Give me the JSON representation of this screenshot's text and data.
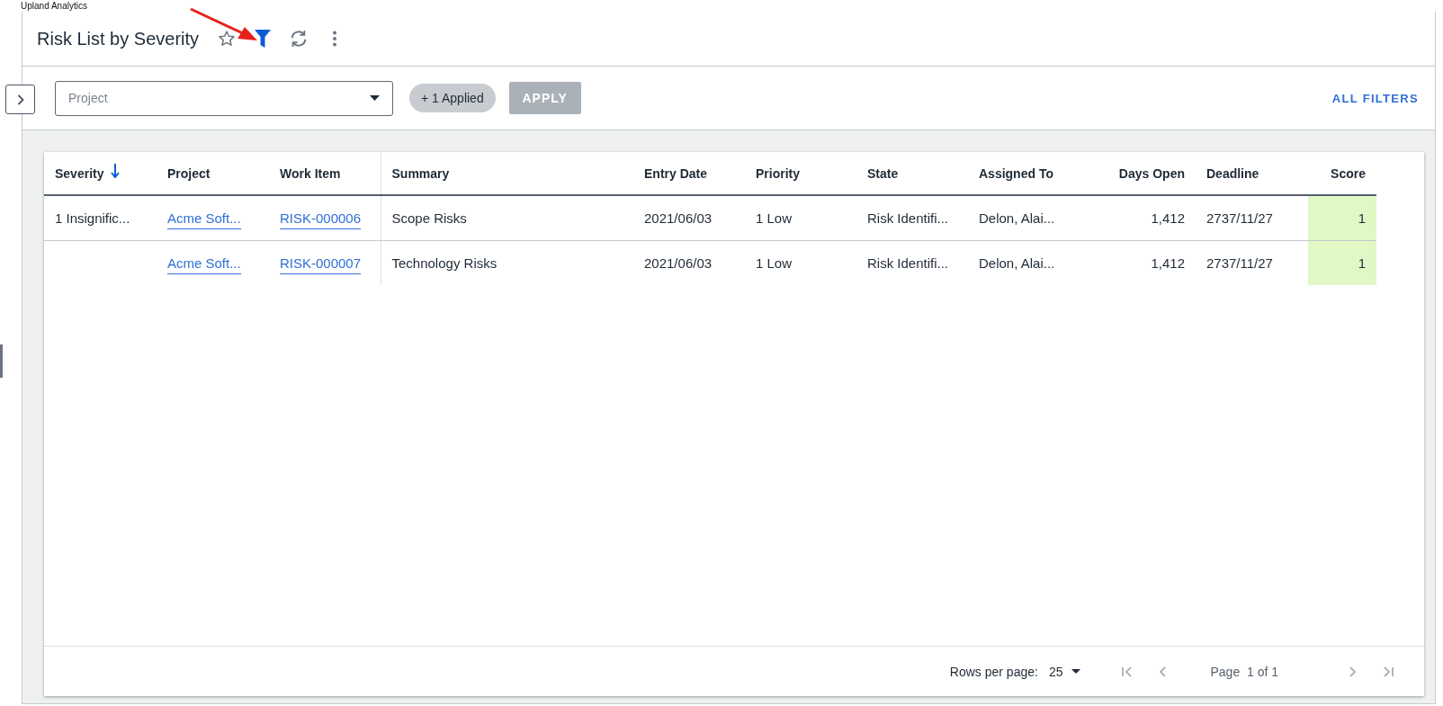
{
  "app_label": "Upland Analytics",
  "header": {
    "title": "Risk List by Severity",
    "favorite": false,
    "filter_active": true
  },
  "filter_bar": {
    "project_field": {
      "placeholder": "Project"
    },
    "applied_chip": "+ 1 Applied",
    "apply_button": {
      "label": "APPLY",
      "disabled": true
    },
    "all_filters_link": "ALL FILTERS"
  },
  "table": {
    "columns": [
      {
        "label": "Severity",
        "kind": "text",
        "sorted": true
      },
      {
        "label": "Project",
        "kind": "link"
      },
      {
        "label": "Work Item",
        "kind": "link"
      },
      {
        "label": "Summary",
        "kind": "text"
      },
      {
        "label": "Entry Date",
        "kind": "text"
      },
      {
        "label": "Priority",
        "kind": "text"
      },
      {
        "label": "State",
        "kind": "text"
      },
      {
        "label": "Assigned To",
        "kind": "text"
      },
      {
        "label": "Days Open",
        "kind": "number"
      },
      {
        "label": "Deadline",
        "kind": "text"
      },
      {
        "label": "Score",
        "kind": "score"
      }
    ],
    "rows": [
      [
        "1 Insignific...",
        "Acme Soft...",
        "RISK-000006",
        "Scope Risks",
        "2021/06/03",
        "1 Low",
        "Risk Identifi...",
        "Delon, Alai...",
        "1,412",
        "2737/11/27",
        "1"
      ],
      [
        null,
        "Acme Soft...",
        "RISK-000007",
        "Technology Risks",
        "2021/06/03",
        "1 Low",
        "Risk Identifi...",
        "Delon, Alai...",
        "1,412",
        "2737/11/27",
        "1"
      ]
    ]
  },
  "pager": {
    "rows_per_page_label": "Rows per page:",
    "rows_per_page": "25",
    "page_text": "Page  1 of 1",
    "nav": [
      {
        "kind": "first",
        "disabled": true
      },
      {
        "kind": "prev",
        "disabled": true
      },
      {
        "kind": "next",
        "disabled": true
      },
      {
        "kind": "last",
        "disabled": true
      }
    ]
  }
}
